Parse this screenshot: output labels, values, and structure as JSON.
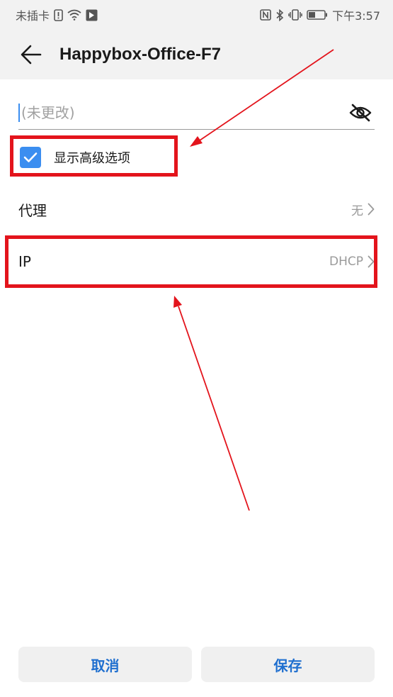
{
  "status_bar": {
    "carrier": "未插卡",
    "time": "下午3:57"
  },
  "header": {
    "title": "Happybox-Office-F7"
  },
  "password": {
    "placeholder": "(未更改)"
  },
  "advanced": {
    "label": "显示高级选项",
    "checked": true
  },
  "rows": [
    {
      "label": "代理",
      "value": "无"
    },
    {
      "label": "IP",
      "value": "DHCP"
    }
  ],
  "buttons": {
    "cancel": "取消",
    "save": "保存"
  },
  "colors": {
    "accent": "#3b8ef0",
    "button_text": "#1f6fcf",
    "annotation": "#e3141c"
  }
}
